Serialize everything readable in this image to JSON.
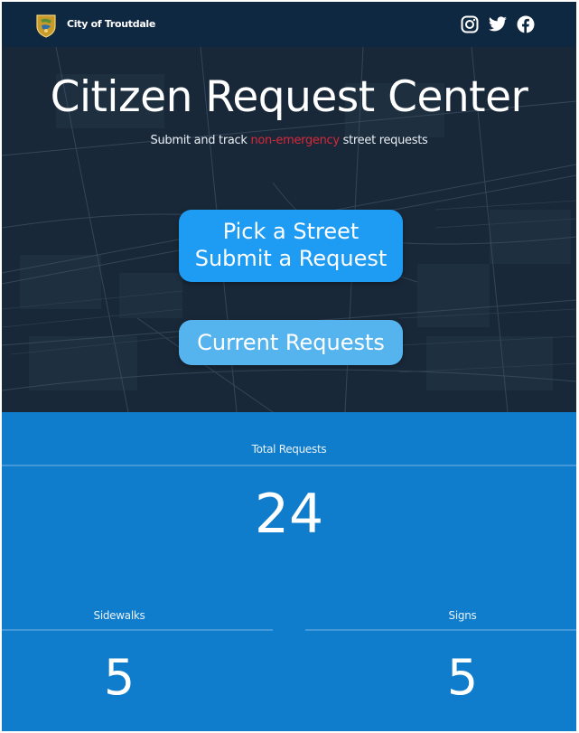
{
  "header": {
    "org_name": "City of Troutdale",
    "social": [
      "instagram-icon",
      "twitter-icon",
      "facebook-icon"
    ]
  },
  "hero": {
    "title": "Citizen Request Center",
    "subtitle_before": "Submit and track ",
    "subtitle_highlight": "non-emergency",
    "subtitle_after": " street requests",
    "highlight_color": "#d6283a"
  },
  "buttons": {
    "pick_line1": "Pick a Street",
    "pick_line2": "Submit a Request",
    "current": "Current Requests"
  },
  "stats": {
    "total_label": "Total Requests",
    "total_value": "24",
    "sidewalks_label": "Sidewalks",
    "sidewalks_value": "5",
    "signs_label": "Signs",
    "signs_value": "5"
  },
  "colors": {
    "header_bg": "#0f2842",
    "stats_bg": "#0f7ccc",
    "button_primary": "#1e9bf2",
    "button_secondary": "#55b4ee"
  }
}
